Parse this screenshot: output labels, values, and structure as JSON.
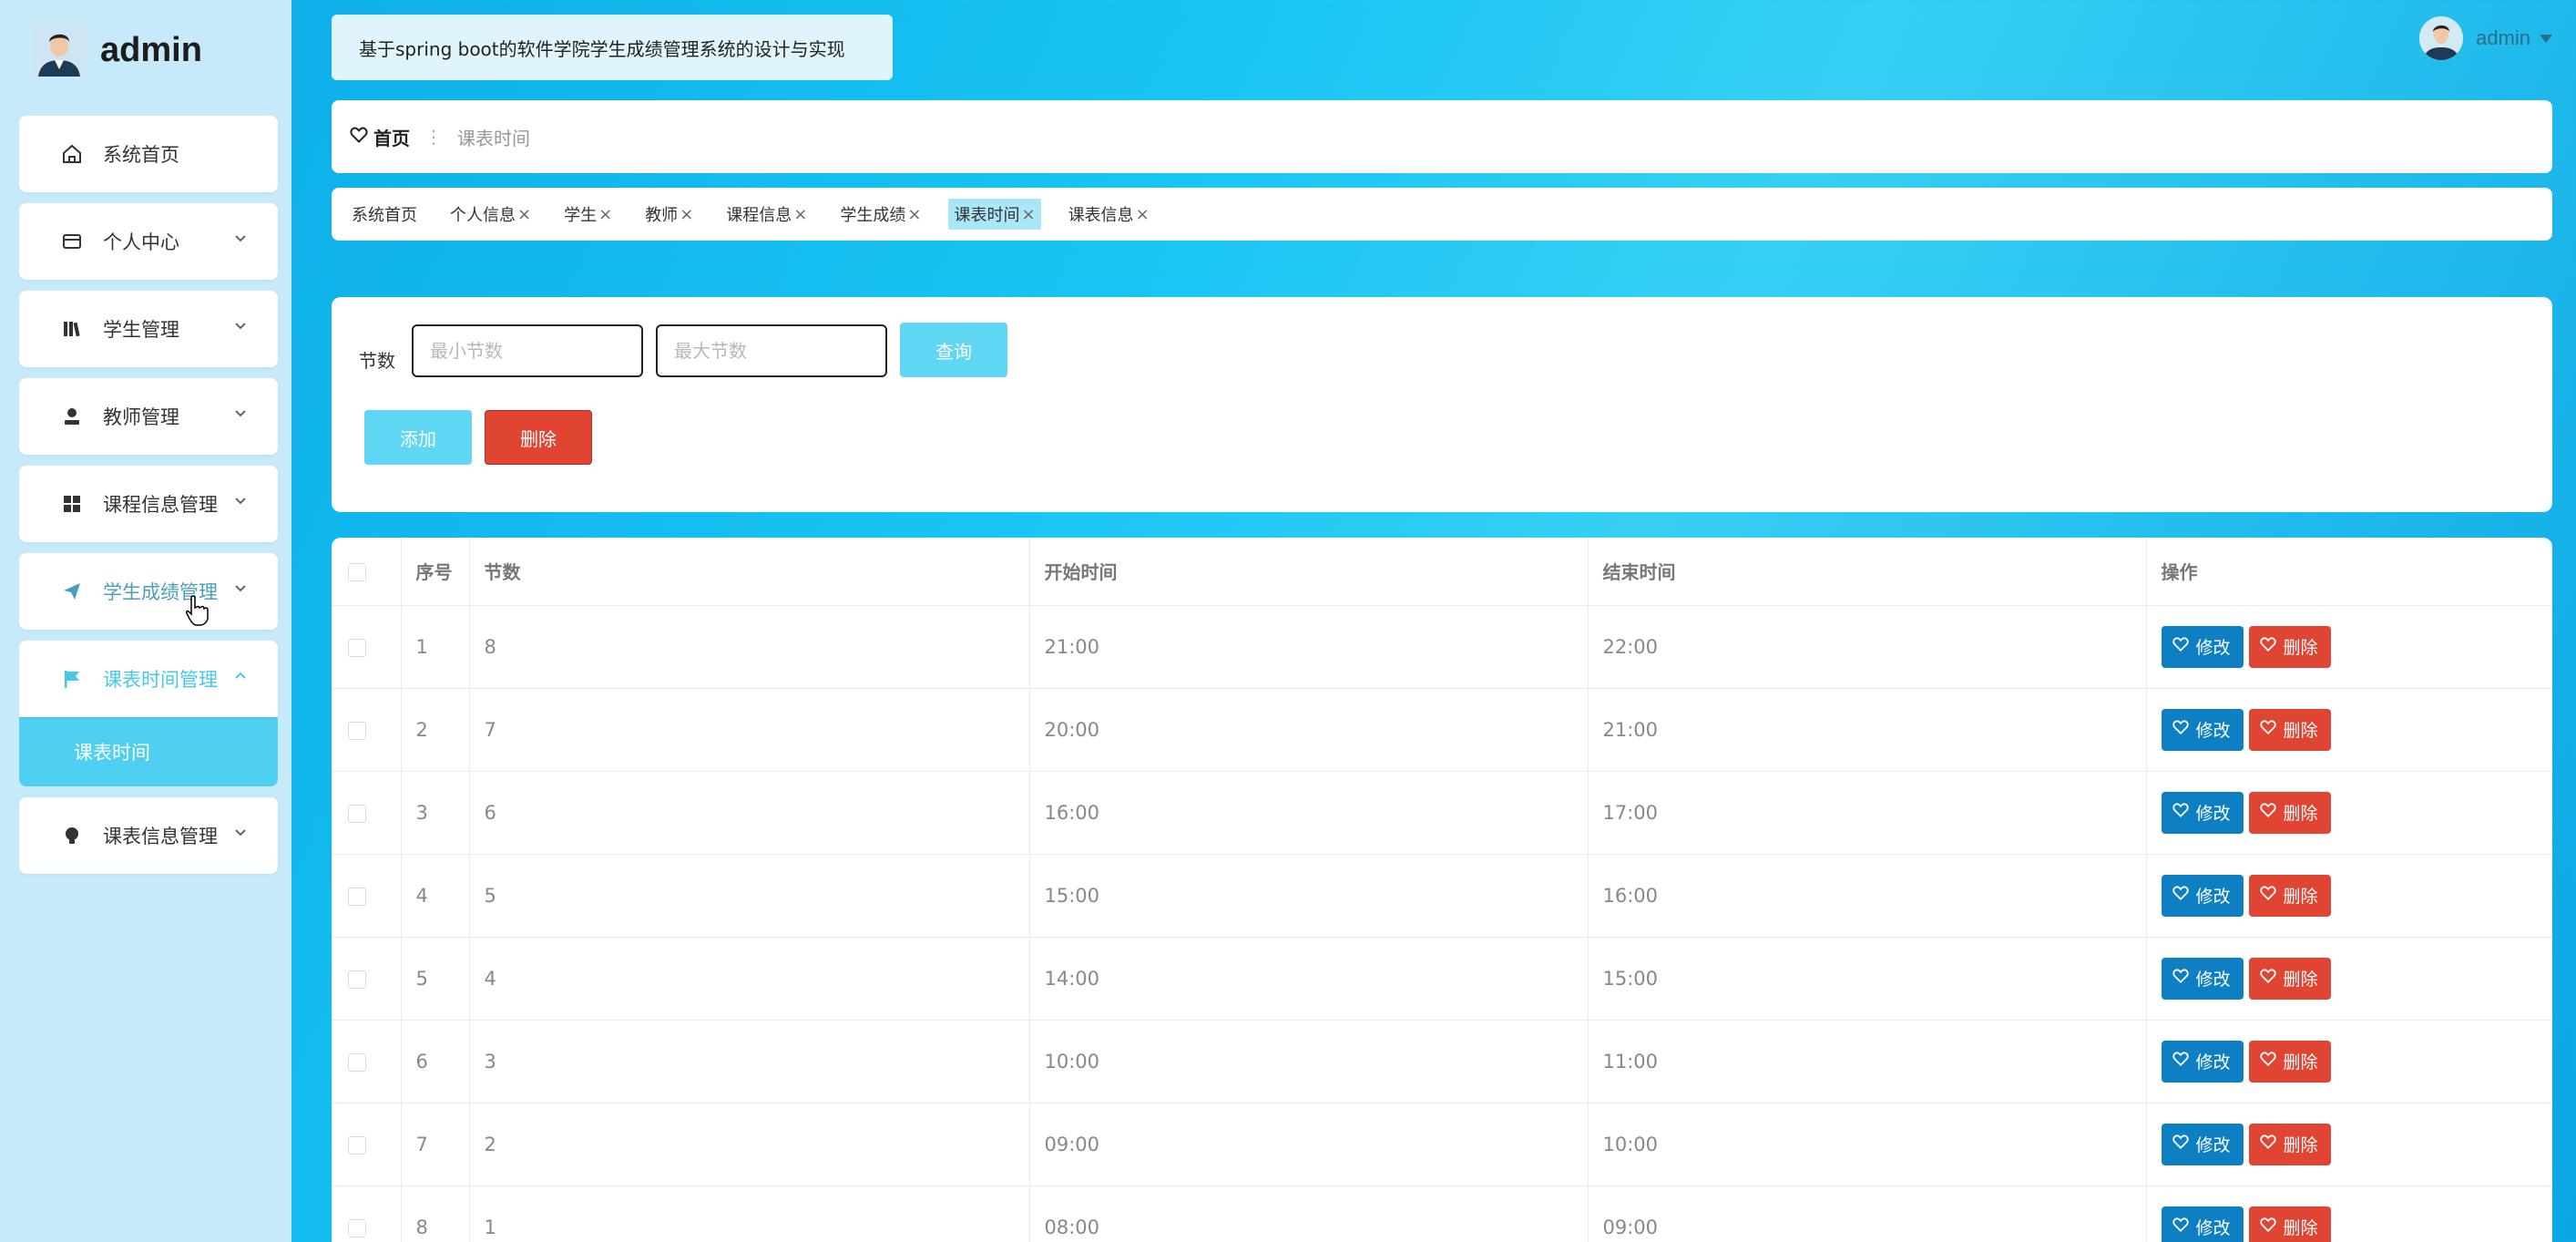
{
  "sidebar": {
    "brand": "admin",
    "menu": [
      {
        "label": "系统首页",
        "icon": "home-icon"
      },
      {
        "label": "个人中心",
        "icon": "card-icon"
      },
      {
        "label": "学生管理",
        "icon": "books-icon"
      },
      {
        "label": "教师管理",
        "icon": "person-icon"
      },
      {
        "label": "课程信息管理",
        "icon": "grid-icon"
      },
      {
        "label": "学生成绩管理",
        "icon": "send-icon"
      },
      {
        "label": "课表时间管理",
        "icon": "flag-icon"
      },
      {
        "label": "课表信息管理",
        "icon": "bulb-icon"
      }
    ],
    "submenu_active": "课表时间"
  },
  "header": {
    "title": "基于spring boot的软件学院学生成绩管理系统的设计与实现",
    "user": "admin"
  },
  "breadcrumb": {
    "home": "首页",
    "separator": "⋮",
    "current": "课表时间"
  },
  "tags": [
    {
      "label": "系统首页",
      "closable": false
    },
    {
      "label": "个人信息",
      "closable": true
    },
    {
      "label": "学生",
      "closable": true
    },
    {
      "label": "教师",
      "closable": true
    },
    {
      "label": "课程信息",
      "closable": true
    },
    {
      "label": "学生成绩",
      "closable": true
    },
    {
      "label": "课表时间",
      "closable": true,
      "active": true
    },
    {
      "label": "课表信息",
      "closable": true
    }
  ],
  "search": {
    "label": "节数",
    "min_placeholder": "最小节数",
    "max_placeholder": "最大节数",
    "query_label": "查询",
    "add_label": "添加",
    "delete_label": "删除"
  },
  "table": {
    "headers": {
      "idx": "序号",
      "section": "节数",
      "start": "开始时间",
      "end": "结束时间",
      "ops": "操作"
    },
    "edit_label": "修改",
    "remove_label": "删除",
    "rows": [
      {
        "idx": "1",
        "section": "8",
        "start": "21:00",
        "end": "22:00"
      },
      {
        "idx": "2",
        "section": "7",
        "start": "20:00",
        "end": "21:00"
      },
      {
        "idx": "3",
        "section": "6",
        "start": "16:00",
        "end": "17:00"
      },
      {
        "idx": "4",
        "section": "5",
        "start": "15:00",
        "end": "16:00"
      },
      {
        "idx": "5",
        "section": "4",
        "start": "14:00",
        "end": "15:00"
      },
      {
        "idx": "6",
        "section": "3",
        "start": "10:00",
        "end": "11:00"
      },
      {
        "idx": "7",
        "section": "2",
        "start": "09:00",
        "end": "10:00"
      },
      {
        "idx": "8",
        "section": "1",
        "start": "08:00",
        "end": "09:00"
      }
    ]
  },
  "colors": {
    "accent": "#4fd0f2",
    "edit": "#0d7fc2",
    "danger": "#e04433"
  }
}
